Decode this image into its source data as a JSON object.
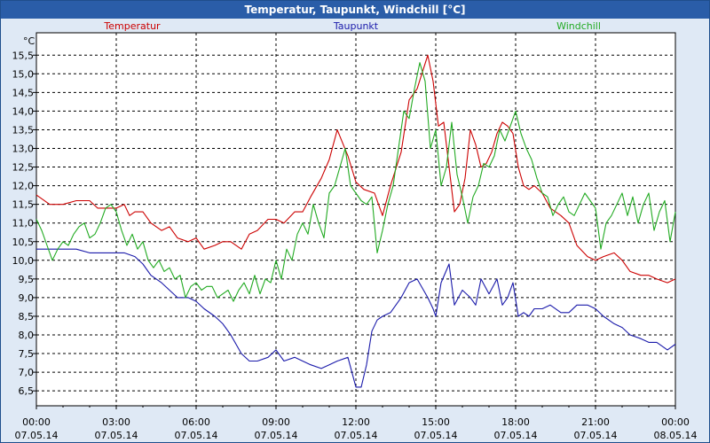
{
  "window": {
    "title": "Temperatur, Taupunkt, Windchill [°C]"
  },
  "chart_data": {
    "type": "line",
    "title": "Temperatur, Taupunkt, Windchill [°C]",
    "ylabel": "°C",
    "xlim": [
      0,
      24
    ],
    "ylim": [
      6.1,
      16.1
    ],
    "grid": true,
    "legend_placement": "top",
    "y_ticks": [
      "6,5",
      "7,0",
      "7,5",
      "8,0",
      "8,5",
      "9,0",
      "9,5",
      "10,0",
      "10,5",
      "11,0",
      "11,5",
      "12,0",
      "12,5",
      "13,0",
      "13,5",
      "14,0",
      "14,5",
      "15,0",
      "15,5"
    ],
    "y_tick_values": [
      6.5,
      7.0,
      7.5,
      8.0,
      8.5,
      9.0,
      9.5,
      10.0,
      10.5,
      11.0,
      11.5,
      12.0,
      12.5,
      13.0,
      13.5,
      14.0,
      14.5,
      15.0,
      15.5
    ],
    "x_ticks": [
      {
        "h": 0,
        "time": "00:00",
        "date": "07.05.14"
      },
      {
        "h": 3,
        "time": "03:00",
        "date": "07.05.14"
      },
      {
        "h": 6,
        "time": "06:00",
        "date": "07.05.14"
      },
      {
        "h": 9,
        "time": "09:00",
        "date": "07.05.14"
      },
      {
        "h": 12,
        "time": "12:00",
        "date": "07.05.14"
      },
      {
        "h": 15,
        "time": "15:00",
        "date": "07.05.14"
      },
      {
        "h": 18,
        "time": "18:00",
        "date": "07.05.14"
      },
      {
        "h": 21,
        "time": "21:00",
        "date": "07.05.14"
      },
      {
        "h": 24,
        "time": "00:00",
        "date": "08.05.14"
      }
    ],
    "series": [
      {
        "name": "Temperatur",
        "color": "#cc0000",
        "x": [
          0,
          0.5,
          1,
          1.5,
          2,
          2.3,
          2.7,
          3,
          3.3,
          3.5,
          3.7,
          4,
          4.3,
          4.7,
          5,
          5.3,
          5.7,
          6,
          6.3,
          6.7,
          7,
          7.3,
          7.7,
          8,
          8.3,
          8.7,
          9,
          9.3,
          9.7,
          10,
          10.3,
          10.7,
          11,
          11.3,
          11.7,
          12,
          12.3,
          12.7,
          13,
          13.3,
          13.7,
          14,
          14.3,
          14.7,
          14.9,
          15.1,
          15.3,
          15.5,
          15.7,
          15.9,
          16.1,
          16.3,
          16.5,
          16.7,
          16.9,
          17.1,
          17.3,
          17.5,
          17.7,
          17.9,
          18.1,
          18.3,
          18.5,
          18.7,
          19,
          19.3,
          19.7,
          20,
          20.3,
          20.7,
          21,
          21.3,
          21.7,
          22,
          22.3,
          22.7,
          23,
          23.3,
          23.7,
          24
        ],
        "y": [
          11.75,
          11.5,
          11.5,
          11.6,
          11.6,
          11.4,
          11.4,
          11.4,
          11.5,
          11.2,
          11.3,
          11.3,
          11.0,
          10.8,
          10.9,
          10.6,
          10.5,
          10.6,
          10.3,
          10.4,
          10.5,
          10.5,
          10.3,
          10.7,
          10.8,
          11.1,
          11.1,
          11.0,
          11.3,
          11.3,
          11.7,
          12.2,
          12.7,
          13.5,
          12.8,
          12.1,
          11.9,
          11.8,
          11.2,
          12.0,
          12.9,
          14.3,
          14.6,
          15.5,
          14.8,
          13.6,
          13.7,
          12.5,
          11.3,
          11.5,
          12.2,
          13.5,
          13.1,
          12.5,
          12.6,
          12.9,
          13.4,
          13.7,
          13.6,
          13.4,
          12.5,
          12.0,
          11.9,
          12.0,
          11.8,
          11.4,
          11.2,
          11.0,
          10.4,
          10.1,
          10.0,
          10.1,
          10.2,
          10.0,
          9.7,
          9.6,
          9.6,
          9.5,
          9.4,
          9.5
        ]
      },
      {
        "name": "Taupunkt",
        "color": "#1a1aaa",
        "x": [
          0,
          0.5,
          1,
          1.5,
          2,
          2.5,
          3,
          3.3,
          3.7,
          4,
          4.3,
          4.7,
          5,
          5.3,
          5.7,
          6,
          6.3,
          6.7,
          7,
          7.3,
          7.7,
          8,
          8.3,
          8.7,
          9,
          9.3,
          9.7,
          10,
          10.3,
          10.7,
          11,
          11.3,
          11.7,
          12,
          12.2,
          12.4,
          12.6,
          12.8,
          13,
          13.3,
          13.7,
          14,
          14.3,
          14.7,
          14.9,
          15,
          15.2,
          15.5,
          15.7,
          16,
          16.3,
          16.5,
          16.7,
          17,
          17.3,
          17.5,
          17.7,
          17.9,
          18.1,
          18.3,
          18.5,
          18.7,
          19,
          19.3,
          19.7,
          20,
          20.3,
          20.7,
          21,
          21.3,
          21.7,
          22,
          22.3,
          22.7,
          23,
          23.3,
          23.7,
          24
        ],
        "y": [
          10.3,
          10.3,
          10.3,
          10.3,
          10.2,
          10.2,
          10.2,
          10.2,
          10.1,
          9.9,
          9.6,
          9.4,
          9.2,
          9.0,
          9.0,
          8.9,
          8.7,
          8.5,
          8.3,
          8.0,
          7.5,
          7.3,
          7.3,
          7.4,
          7.6,
          7.3,
          7.4,
          7.3,
          7.2,
          7.1,
          7.2,
          7.3,
          7.4,
          6.6,
          6.6,
          7.2,
          8.1,
          8.4,
          8.5,
          8.6,
          9.0,
          9.4,
          9.5,
          9.0,
          8.7,
          8.5,
          9.4,
          9.9,
          8.8,
          9.2,
          9.0,
          8.8,
          9.5,
          9.1,
          9.5,
          8.8,
          9.0,
          9.4,
          8.5,
          8.6,
          8.5,
          8.7,
          8.7,
          8.8,
          8.6,
          8.6,
          8.8,
          8.8,
          8.7,
          8.5,
          8.3,
          8.2,
          8.0,
          7.9,
          7.8,
          7.8,
          7.6,
          7.75
        ]
      },
      {
        "name": "Windchill",
        "color": "#22aa22",
        "x": [
          0,
          0.2,
          0.4,
          0.6,
          0.8,
          1,
          1.2,
          1.4,
          1.6,
          1.8,
          2,
          2.2,
          2.4,
          2.6,
          2.8,
          3,
          3.2,
          3.4,
          3.6,
          3.8,
          4,
          4.2,
          4.4,
          4.6,
          4.8,
          5,
          5.2,
          5.4,
          5.6,
          5.8,
          6,
          6.2,
          6.4,
          6.6,
          6.8,
          7,
          7.2,
          7.4,
          7.6,
          7.8,
          8,
          8.2,
          8.4,
          8.6,
          8.8,
          9,
          9.2,
          9.4,
          9.6,
          9.8,
          10,
          10.2,
          10.4,
          10.6,
          10.8,
          11,
          11.2,
          11.4,
          11.6,
          11.8,
          12,
          12.2,
          12.4,
          12.6,
          12.8,
          13,
          13.2,
          13.4,
          13.6,
          13.8,
          14,
          14.2,
          14.4,
          14.6,
          14.8,
          15,
          15.2,
          15.4,
          15.6,
          15.8,
          16,
          16.2,
          16.4,
          16.6,
          16.8,
          17,
          17.2,
          17.4,
          17.6,
          17.8,
          18,
          18.2,
          18.4,
          18.6,
          18.8,
          19,
          19.2,
          19.4,
          19.6,
          19.8,
          20,
          20.2,
          20.4,
          20.6,
          20.8,
          21,
          21.2,
          21.4,
          21.6,
          21.8,
          22,
          22.2,
          22.4,
          22.6,
          22.8,
          23,
          23.2,
          23.4,
          23.6,
          23.8,
          24
        ],
        "y": [
          11.1,
          10.8,
          10.4,
          10.0,
          10.3,
          10.5,
          10.4,
          10.7,
          10.9,
          11.0,
          10.6,
          10.7,
          11.0,
          11.4,
          11.5,
          11.3,
          10.8,
          10.4,
          10.7,
          10.3,
          10.5,
          10.0,
          9.8,
          10.0,
          9.7,
          9.8,
          9.5,
          9.6,
          9.0,
          9.3,
          9.4,
          9.2,
          9.3,
          9.3,
          9.0,
          9.1,
          9.2,
          8.9,
          9.2,
          9.4,
          9.1,
          9.6,
          9.1,
          9.5,
          9.4,
          10.0,
          9.5,
          10.3,
          10.0,
          10.7,
          11.0,
          10.7,
          11.5,
          11.0,
          10.6,
          11.8,
          12.0,
          12.5,
          13.0,
          12.0,
          11.8,
          11.6,
          11.5,
          11.7,
          10.2,
          10.8,
          11.5,
          12.0,
          13.0,
          14.0,
          13.8,
          14.6,
          15.3,
          14.8,
          13.0,
          13.5,
          12.0,
          12.5,
          13.7,
          12.3,
          11.7,
          11.0,
          11.7,
          12.0,
          12.6,
          12.5,
          12.8,
          13.5,
          13.2,
          13.6,
          14.0,
          13.4,
          13.0,
          12.7,
          12.2,
          11.8,
          11.7,
          11.2,
          11.5,
          11.7,
          11.3,
          11.2,
          11.5,
          11.8,
          11.6,
          11.4,
          10.3,
          11.0,
          11.2,
          11.5,
          11.8,
          11.2,
          11.7,
          11.0,
          11.5,
          11.8,
          10.8,
          11.3,
          11.6,
          10.5,
          11.3
        ]
      }
    ]
  }
}
